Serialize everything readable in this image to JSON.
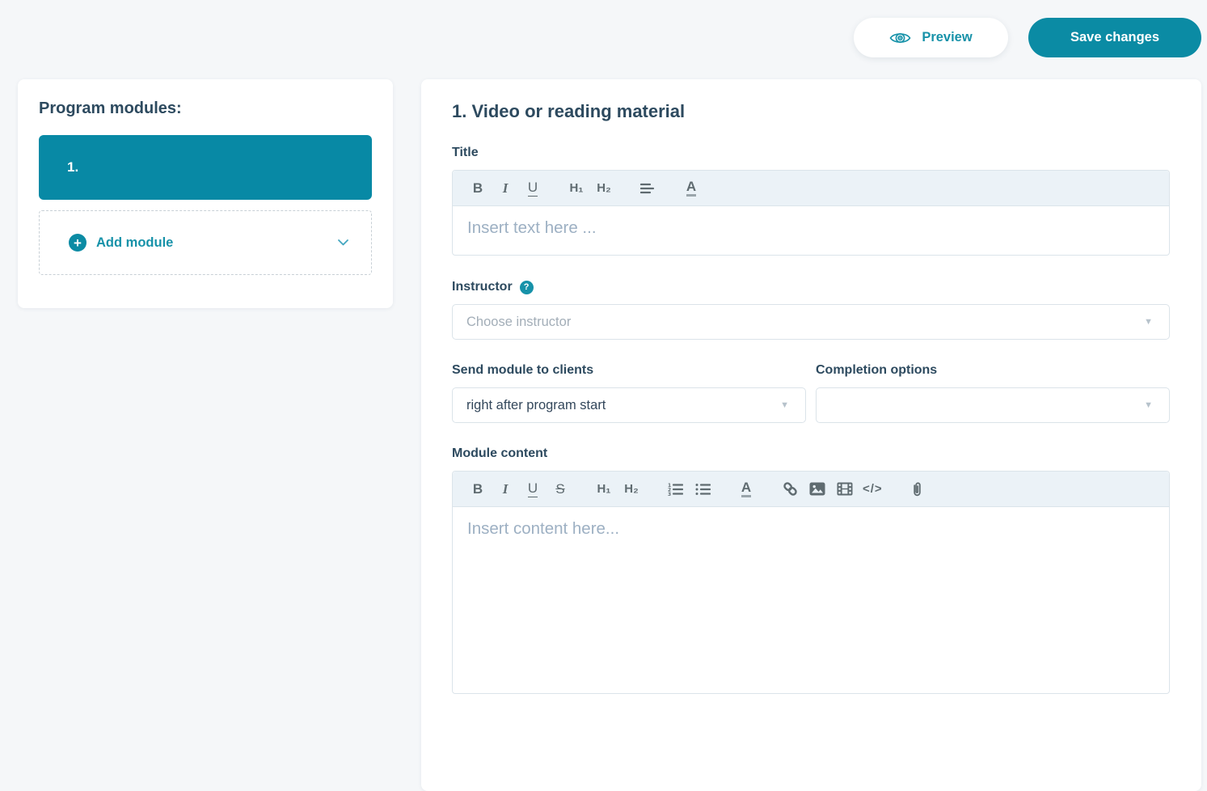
{
  "header": {
    "preview_button": {
      "label": "Preview"
    },
    "save_button": {
      "label": "Save changes"
    }
  },
  "sidebar": {
    "title": "Program modules:",
    "modules": [
      {
        "label": "1."
      }
    ],
    "add_module": {
      "label": "Add module",
      "plus_glyph": "+"
    }
  },
  "module_editor": {
    "heading": "1. Video or reading material",
    "title_field": {
      "label": "Title",
      "placeholder": "Insert text here ..."
    },
    "instructor_field": {
      "label": "Instructor",
      "help_glyph": "?",
      "placeholder": "Choose instructor"
    },
    "send_module_field": {
      "label": "Send module to clients",
      "value": "right after program start"
    },
    "completion_field": {
      "label": "Completion options",
      "value": ""
    },
    "content_field": {
      "label": "Module content",
      "placeholder": "Insert content here..."
    }
  },
  "toolbar_glyphs": {
    "bold": "B",
    "italic": "I",
    "underline": "U",
    "strike": "S",
    "h1": "H₁",
    "h2": "H₂",
    "color": "A",
    "code": "</>"
  },
  "icons": {
    "caret": "▼"
  },
  "colors": {
    "teal": "#0889a5",
    "teal_dark": "#0b8ba4",
    "dark_text": "#2d4a5f",
    "toolbar_bg": "#ebf2f7"
  }
}
